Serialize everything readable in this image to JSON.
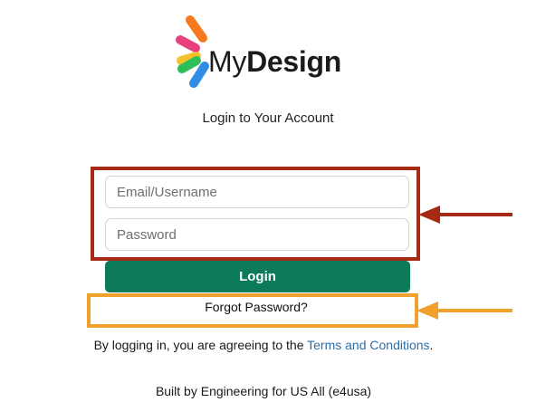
{
  "logo": {
    "name_regular": "My",
    "name_bold": "Design",
    "petal_colors": [
      "#f7791f",
      "#e8407e",
      "#f6c12c",
      "#2ebf5b",
      "#2f8ee3"
    ]
  },
  "login_card": {
    "title": "Login to Your Account",
    "email_placeholder": "Email/Username",
    "password_placeholder": "Password",
    "login_label": "Login",
    "forgot_label": "Forgot Password?"
  },
  "agreement": {
    "prefix": "By logging in, you are agreeing to the ",
    "terms_label": "Terms and Conditions",
    "suffix": "."
  },
  "footer": {
    "text": "Built by Engineering for US All (e4usa)"
  },
  "annotations": {
    "red_color": "#a52a12",
    "orange_color": "#f0a02c",
    "button_color": "#0d7a5a"
  }
}
